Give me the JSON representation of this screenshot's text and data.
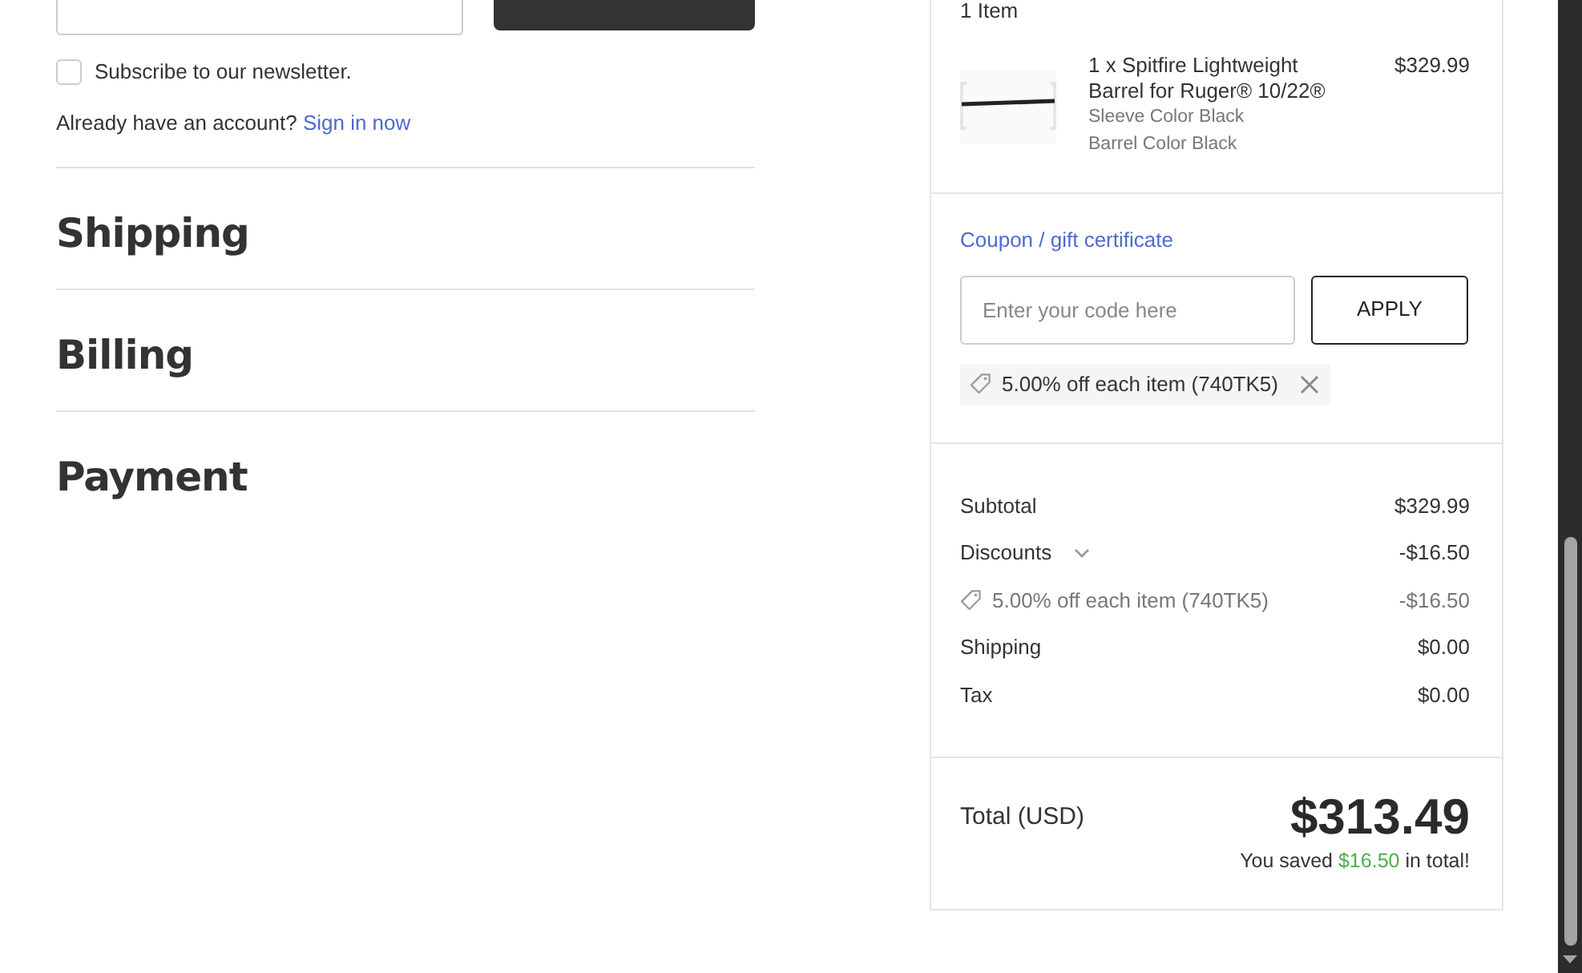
{
  "newsletter": {
    "label": "Subscribe to our newsletter.",
    "checked": false
  },
  "account_prompt": {
    "text": "Already have an account?",
    "link": "Sign in now"
  },
  "sections": [
    {
      "title": "Shipping"
    },
    {
      "title": "Billing"
    },
    {
      "title": "Payment"
    }
  ],
  "summary": {
    "item_count": "1 Item",
    "items": [
      {
        "name": "1 x Spitfire Lightweight Barrel for Ruger® 10/22®",
        "price": "$329.99",
        "options": [
          "Sleeve Color Black",
          "Barrel Color Black"
        ]
      }
    ],
    "coupon": {
      "link": "Coupon / gift certificate",
      "placeholder": "Enter your code here",
      "button": "APPLY",
      "applied": [
        {
          "label": "5.00% off each item (740TK5)"
        }
      ]
    },
    "lines": [
      {
        "kind": "amount",
        "label": "Subtotal",
        "amount": "$329.99"
      },
      {
        "kind": "discounts",
        "label": "Discounts",
        "amount": "-$16.50",
        "expanded": true,
        "children": [
          {
            "label": "5.00% off each item (740TK5)",
            "amount": "-$16.50"
          }
        ]
      },
      {
        "kind": "amount",
        "label": "Shipping",
        "amount": "$0.00"
      },
      {
        "kind": "amount",
        "label": "Tax",
        "amount": "$0.00"
      }
    ],
    "total": {
      "label": "Total (USD)",
      "amount": "$313.49",
      "saved_before": "You saved",
      "saved_amount": "$16.50",
      "saved_after": "in total!"
    }
  }
}
